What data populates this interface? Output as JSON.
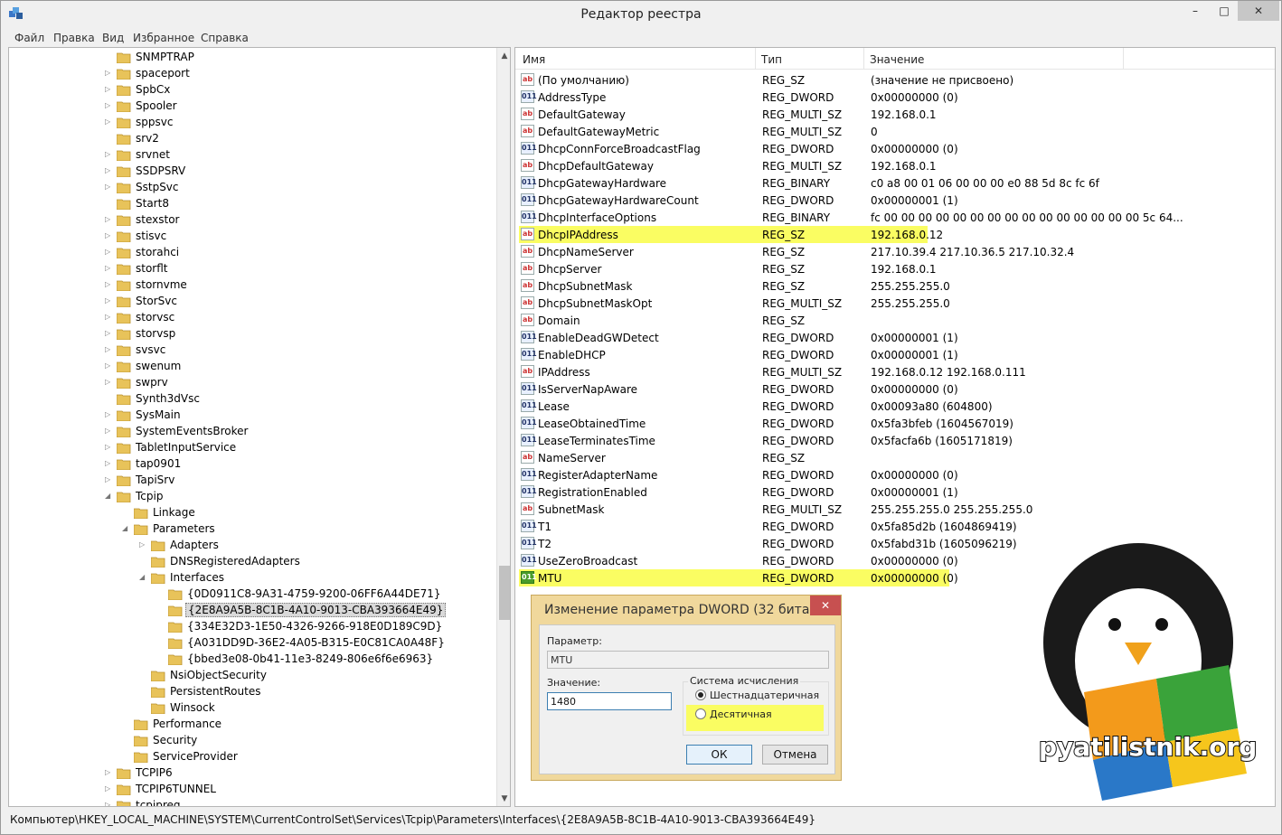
{
  "window": {
    "title": "Редактор реестра",
    "controls": {
      "minimize": "–",
      "maximize": "□",
      "close": "✕"
    }
  },
  "menu": [
    "Файл",
    "Правка",
    "Вид",
    "Избранное",
    "Справка"
  ],
  "tree": [
    {
      "label": "SNMPTRAP",
      "level": 0,
      "expander": "",
      "selected": false
    },
    {
      "label": "spaceport",
      "level": 0,
      "expander": "▷",
      "selected": false
    },
    {
      "label": "SpbCx",
      "level": 0,
      "expander": "▷",
      "selected": false
    },
    {
      "label": "Spooler",
      "level": 0,
      "expander": "▷",
      "selected": false
    },
    {
      "label": "sppsvc",
      "level": 0,
      "expander": "▷",
      "selected": false
    },
    {
      "label": "srv2",
      "level": 0,
      "expander": "",
      "selected": false
    },
    {
      "label": "srvnet",
      "level": 0,
      "expander": "▷",
      "selected": false
    },
    {
      "label": "SSDPSRV",
      "level": 0,
      "expander": "▷",
      "selected": false
    },
    {
      "label": "SstpSvc",
      "level": 0,
      "expander": "▷",
      "selected": false
    },
    {
      "label": "Start8",
      "level": 0,
      "expander": "",
      "selected": false
    },
    {
      "label": "stexstor",
      "level": 0,
      "expander": "▷",
      "selected": false
    },
    {
      "label": "stisvc",
      "level": 0,
      "expander": "▷",
      "selected": false
    },
    {
      "label": "storahci",
      "level": 0,
      "expander": "▷",
      "selected": false
    },
    {
      "label": "storflt",
      "level": 0,
      "expander": "▷",
      "selected": false
    },
    {
      "label": "stornvme",
      "level": 0,
      "expander": "▷",
      "selected": false
    },
    {
      "label": "StorSvc",
      "level": 0,
      "expander": "▷",
      "selected": false
    },
    {
      "label": "storvsc",
      "level": 0,
      "expander": "▷",
      "selected": false
    },
    {
      "label": "storvsp",
      "level": 0,
      "expander": "▷",
      "selected": false
    },
    {
      "label": "svsvc",
      "level": 0,
      "expander": "▷",
      "selected": false
    },
    {
      "label": "swenum",
      "level": 0,
      "expander": "▷",
      "selected": false
    },
    {
      "label": "swprv",
      "level": 0,
      "expander": "▷",
      "selected": false
    },
    {
      "label": "Synth3dVsc",
      "level": 0,
      "expander": "",
      "selected": false
    },
    {
      "label": "SysMain",
      "level": 0,
      "expander": "▷",
      "selected": false
    },
    {
      "label": "SystemEventsBroker",
      "level": 0,
      "expander": "▷",
      "selected": false
    },
    {
      "label": "TabletInputService",
      "level": 0,
      "expander": "▷",
      "selected": false
    },
    {
      "label": "tap0901",
      "level": 0,
      "expander": "▷",
      "selected": false
    },
    {
      "label": "TapiSrv",
      "level": 0,
      "expander": "▷",
      "selected": false
    },
    {
      "label": "Tcpip",
      "level": 0,
      "expander": "◢",
      "selected": false
    },
    {
      "label": "Linkage",
      "level": 1,
      "expander": "",
      "selected": false
    },
    {
      "label": "Parameters",
      "level": 1,
      "expander": "◢",
      "selected": false
    },
    {
      "label": "Adapters",
      "level": 2,
      "expander": "▷",
      "selected": false
    },
    {
      "label": "DNSRegisteredAdapters",
      "level": 2,
      "expander": "",
      "selected": false
    },
    {
      "label": "Interfaces",
      "level": 2,
      "expander": "◢",
      "selected": false
    },
    {
      "label": "{0D0911C8-9A31-4759-9200-06FF6A44DE71}",
      "level": 3,
      "expander": "",
      "selected": false
    },
    {
      "label": "{2E8A9A5B-8C1B-4A10-9013-CBA393664E49}",
      "level": 3,
      "expander": "",
      "selected": true
    },
    {
      "label": "{334E32D3-1E50-4326-9266-918E0D189C9D}",
      "level": 3,
      "expander": "",
      "selected": false
    },
    {
      "label": "{A031DD9D-36E2-4A05-B315-E0C81CA0A48F}",
      "level": 3,
      "expander": "",
      "selected": false
    },
    {
      "label": "{bbed3e08-0b41-11e3-8249-806e6f6e6963}",
      "level": 3,
      "expander": "",
      "selected": false
    },
    {
      "label": "NsiObjectSecurity",
      "level": 2,
      "expander": "",
      "selected": false
    },
    {
      "label": "PersistentRoutes",
      "level": 2,
      "expander": "",
      "selected": false
    },
    {
      "label": "Winsock",
      "level": 2,
      "expander": "",
      "selected": false
    },
    {
      "label": "Performance",
      "level": 1,
      "expander": "",
      "selected": false
    },
    {
      "label": "Security",
      "level": 1,
      "expander": "",
      "selected": false
    },
    {
      "label": "ServiceProvider",
      "level": 1,
      "expander": "",
      "selected": false
    },
    {
      "label": "TCPIP6",
      "level": 0,
      "expander": "▷",
      "selected": false
    },
    {
      "label": "TCPIP6TUNNEL",
      "level": 0,
      "expander": "▷",
      "selected": false
    },
    {
      "label": "tcpipreg",
      "level": 0,
      "expander": "▷",
      "selected": false
    }
  ],
  "columns": {
    "name": "Имя",
    "type": "Тип",
    "data": "Значение"
  },
  "values": [
    {
      "name": "(По умолчанию)",
      "type": "REG_SZ",
      "data": "(значение не присвоено)",
      "kind": "sz",
      "highlight": false
    },
    {
      "name": "AddressType",
      "type": "REG_DWORD",
      "data": "0x00000000 (0)",
      "kind": "dw",
      "highlight": false
    },
    {
      "name": "DefaultGateway",
      "type": "REG_MULTI_SZ",
      "data": "192.168.0.1",
      "kind": "sz",
      "highlight": false
    },
    {
      "name": "DefaultGatewayMetric",
      "type": "REG_MULTI_SZ",
      "data": "0",
      "kind": "sz",
      "highlight": false
    },
    {
      "name": "DhcpConnForceBroadcastFlag",
      "type": "REG_DWORD",
      "data": "0x00000000 (0)",
      "kind": "dw",
      "highlight": false
    },
    {
      "name": "DhcpDefaultGateway",
      "type": "REG_MULTI_SZ",
      "data": "192.168.0.1",
      "kind": "sz",
      "highlight": false
    },
    {
      "name": "DhcpGatewayHardware",
      "type": "REG_BINARY",
      "data": "c0 a8 00 01 06 00 00 00 e0 88 5d 8c fc 6f",
      "kind": "dw",
      "highlight": false
    },
    {
      "name": "DhcpGatewayHardwareCount",
      "type": "REG_DWORD",
      "data": "0x00000001 (1)",
      "kind": "dw",
      "highlight": false
    },
    {
      "name": "DhcpInterfaceOptions",
      "type": "REG_BINARY",
      "data": "fc 00 00 00 00 00 00 00 00 00 00 00 00 00 00 00 5c 64...",
      "kind": "dw",
      "highlight": false
    },
    {
      "name": "DhcpIPAddress",
      "type": "REG_SZ",
      "data": "192.168.0.12",
      "kind": "sz",
      "highlight": true
    },
    {
      "name": "DhcpNameServer",
      "type": "REG_SZ",
      "data": "217.10.39.4 217.10.36.5 217.10.32.4",
      "kind": "sz",
      "highlight": false
    },
    {
      "name": "DhcpServer",
      "type": "REG_SZ",
      "data": "192.168.0.1",
      "kind": "sz",
      "highlight": false
    },
    {
      "name": "DhcpSubnetMask",
      "type": "REG_SZ",
      "data": "255.255.255.0",
      "kind": "sz",
      "highlight": false
    },
    {
      "name": "DhcpSubnetMaskOpt",
      "type": "REG_MULTI_SZ",
      "data": "255.255.255.0",
      "kind": "sz",
      "highlight": false
    },
    {
      "name": "Domain",
      "type": "REG_SZ",
      "data": "",
      "kind": "sz",
      "highlight": false
    },
    {
      "name": "EnableDeadGWDetect",
      "type": "REG_DWORD",
      "data": "0x00000001 (1)",
      "kind": "dw",
      "highlight": false
    },
    {
      "name": "EnableDHCP",
      "type": "REG_DWORD",
      "data": "0x00000001 (1)",
      "kind": "dw",
      "highlight": false
    },
    {
      "name": "IPAddress",
      "type": "REG_MULTI_SZ",
      "data": "192.168.0.12 192.168.0.111",
      "kind": "sz",
      "highlight": false
    },
    {
      "name": "IsServerNapAware",
      "type": "REG_DWORD",
      "data": "0x00000000 (0)",
      "kind": "dw",
      "highlight": false
    },
    {
      "name": "Lease",
      "type": "REG_DWORD",
      "data": "0x00093a80 (604800)",
      "kind": "dw",
      "highlight": false
    },
    {
      "name": "LeaseObtainedTime",
      "type": "REG_DWORD",
      "data": "0x5fa3bfeb (1604567019)",
      "kind": "dw",
      "highlight": false
    },
    {
      "name": "LeaseTerminatesTime",
      "type": "REG_DWORD",
      "data": "0x5facfa6b (1605171819)",
      "kind": "dw",
      "highlight": false
    },
    {
      "name": "NameServer",
      "type": "REG_SZ",
      "data": "",
      "kind": "sz",
      "highlight": false
    },
    {
      "name": "RegisterAdapterName",
      "type": "REG_DWORD",
      "data": "0x00000000 (0)",
      "kind": "dw",
      "highlight": false
    },
    {
      "name": "RegistrationEnabled",
      "type": "REG_DWORD",
      "data": "0x00000001 (1)",
      "kind": "dw",
      "highlight": false
    },
    {
      "name": "SubnetMask",
      "type": "REG_MULTI_SZ",
      "data": "255.255.255.0 255.255.255.0",
      "kind": "sz",
      "highlight": false
    },
    {
      "name": "T1",
      "type": "REG_DWORD",
      "data": "0x5fa85d2b (1604869419)",
      "kind": "dw",
      "highlight": false
    },
    {
      "name": "T2",
      "type": "REG_DWORD",
      "data": "0x5fabd31b (1605096219)",
      "kind": "dw",
      "highlight": false
    },
    {
      "name": "UseZeroBroadcast",
      "type": "REG_DWORD",
      "data": "0x00000000 (0)",
      "kind": "dw",
      "highlight": false
    },
    {
      "name": "MTU",
      "type": "REG_DWORD",
      "data": "0x00000000 (0)",
      "kind": "mtu",
      "highlight": true
    }
  ],
  "icon_glyphs": {
    "sz": "ab",
    "dw": "011",
    "mtu": "011"
  },
  "status_path": "Компьютер\\HKEY_LOCAL_MACHINE\\SYSTEM\\CurrentControlSet\\Services\\Tcpip\\Parameters\\Interfaces\\{2E8A9A5B-8C1B-4A10-9013-CBA393664E49}",
  "dialog": {
    "title": "Изменение параметра DWORD (32 бита)",
    "param_label": "Параметр:",
    "param_value": "MTU",
    "value_label": "Значение:",
    "value": "1480",
    "base_label": "Система исчисления",
    "hex_label": "Шестнадцатеричная",
    "dec_label": "Десятичная",
    "hex_selected": true,
    "ok": "ОК",
    "cancel": "Отмена",
    "close": "✕"
  },
  "watermark": {
    "text": "pyatilistnik.org"
  },
  "colors": {
    "highlight": "#fafd62",
    "selection": "#d9d9d9",
    "folder": "#e8c35a"
  }
}
